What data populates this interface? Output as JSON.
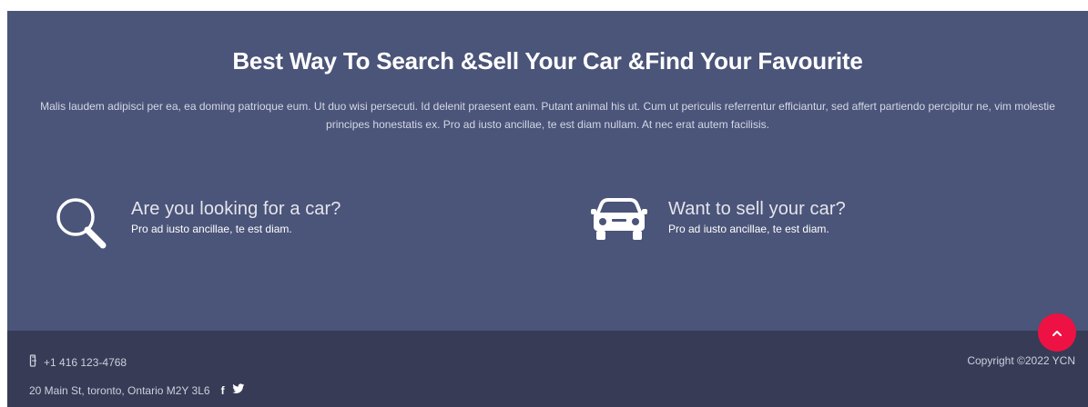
{
  "hero": {
    "title": "Best Way To Search &Sell Your Car &Find Your Favourite",
    "description": "Malis laudem adipisci per ea, ea doming patrioque eum. Ut duo wisi persecuti. Id delenit praesent eam. Putant animal his ut. Cum ut periculis referrentur efficiantur, sed affert partiendo percipitur ne, vim molestie principes honestatis ex. Pro ad iusto ancillae, te est diam nullam. At nec erat autem facilisis."
  },
  "features": [
    {
      "icon": "search-icon",
      "title": "Are you looking for a car?",
      "subtitle": "Pro ad iusto ancillae, te est diam."
    },
    {
      "icon": "car-icon",
      "title": "Want to sell your car?",
      "subtitle": "Pro ad iusto ancillae, te est diam."
    }
  ],
  "footer": {
    "phone": "+1 416 123-4768",
    "address": "20 Main St, toronto, Ontario M2Y 3L6",
    "copyright": "Copyright ©2022 YCN",
    "social": [
      "facebook-icon",
      "twitter-icon"
    ]
  },
  "scroll_top": {
    "icon": "chevron-up-icon"
  },
  "colors": {
    "hero_bg": "#4b5479",
    "footer_bg": "#373b56",
    "accent": "#ee1244",
    "text": "#ffffff"
  }
}
